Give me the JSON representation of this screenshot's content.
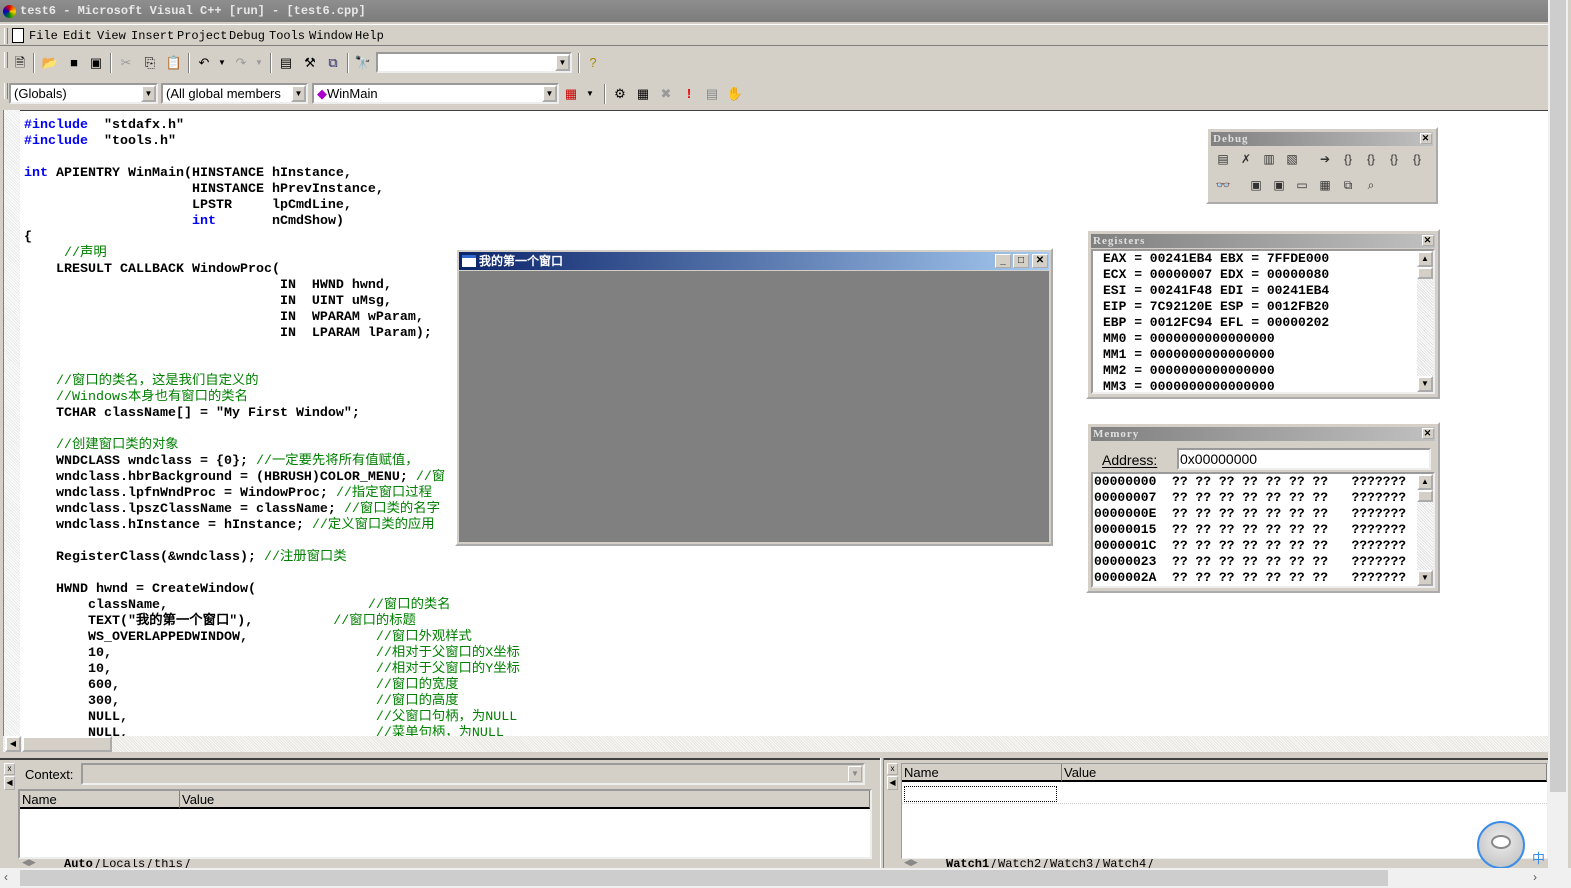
{
  "window": {
    "title": "test6 - Microsoft Visual C++ [run] - [test6.cpp]"
  },
  "menu": [
    "File",
    "Edit",
    "View",
    "Insert",
    "Project",
    "Debug",
    "Tools",
    "Window",
    "Help"
  ],
  "toolbar": {
    "icons": [
      "new-text-file",
      "open",
      "save",
      "save-all",
      "cut",
      "copy",
      "paste",
      "undo",
      "redo",
      "workspace",
      "output",
      "window-list",
      "find-in-files"
    ],
    "find_combo": "",
    "help_icon": "help-search"
  },
  "wizardbar": {
    "class_combo": "(Globals)",
    "filter_combo": "(All global members",
    "member_combo": "WinMain"
  },
  "code": [
    [
      [
        "kw",
        "#include"
      ],
      [
        "",
        "  \"stdafx.h\""
      ]
    ],
    [
      [
        "kw",
        "#include"
      ],
      [
        "",
        "  \"tools.h\""
      ]
    ],
    [],
    [
      [
        "kw",
        "int"
      ],
      [
        "",
        " APIENTRY WinMain(HINSTANCE hInstance,"
      ]
    ],
    [
      [
        "",
        "                     HINSTANCE hPrevInstance,"
      ]
    ],
    [
      [
        "",
        "                     LPSTR     lpCmdLine,"
      ]
    ],
    [
      [
        "",
        "                     "
      ],
      [
        "kw",
        "int"
      ],
      [
        "",
        "       nCmdShow)"
      ]
    ],
    [
      [
        "",
        "{"
      ]
    ],
    [
      [
        "cm",
        "     //声明"
      ]
    ],
    [
      [
        "",
        "    LRESULT CALLBACK WindowProc("
      ]
    ],
    [
      [
        "",
        "                                IN  HWND hwnd,"
      ]
    ],
    [
      [
        "",
        "                                IN  UINT uMsg,"
      ]
    ],
    [
      [
        "",
        "                                IN  WPARAM wParam,"
      ]
    ],
    [
      [
        "",
        "                                IN  LPARAM lParam);"
      ]
    ],
    [],
    [],
    [
      [
        "cm",
        "    //窗口的类名，这是我们自定义的"
      ]
    ],
    [
      [
        "cm",
        "    //Windows本身也有窗口的类名"
      ]
    ],
    [
      [
        "",
        "    TCHAR className[] = \"My First Window\";"
      ]
    ],
    [],
    [
      [
        "cm",
        "    //创建窗口类的对象"
      ]
    ],
    [
      [
        "",
        "    WNDCLASS wndclass = {0}; "
      ],
      [
        "cm",
        "//一定要先将所有值赋值，"
      ]
    ],
    [
      [
        "",
        "    wndclass.hbrBackground = (HBRUSH)COLOR_MENU; "
      ],
      [
        "cm",
        "//窗"
      ]
    ],
    [
      [
        "",
        "    wndclass.lpfnWndProc = WindowProc; "
      ],
      [
        "cm",
        "//指定窗口过程"
      ]
    ],
    [
      [
        "",
        "    wndclass.lpszClassName = className; "
      ],
      [
        "cm",
        "//窗口类的名字"
      ]
    ],
    [
      [
        "",
        "    wndclass.hInstance = hInstance; "
      ],
      [
        "cm",
        "//定义窗口类的应用"
      ]
    ],
    [],
    [
      [
        "",
        "    RegisterClass(&wndclass); "
      ],
      [
        "cm",
        "//注册窗口类"
      ]
    ],
    [],
    [
      [
        "",
        "    HWND hwnd = CreateWindow("
      ]
    ],
    [
      [
        "",
        "        className,                    "
      ],
      [
        "cm",
        "     //窗口的类名"
      ]
    ],
    [
      [
        "",
        "        TEXT(\"我的第一个窗口\"),          "
      ],
      [
        "cm",
        "//窗口的标题"
      ]
    ],
    [
      [
        "",
        "        WS_OVERLAPPEDWINDOW,                "
      ],
      [
        "cm",
        "//窗口外观样式"
      ]
    ],
    [
      [
        "",
        "        10,                                 "
      ],
      [
        "cm",
        "//相对于父窗口的X坐标"
      ]
    ],
    [
      [
        "",
        "        10,                                 "
      ],
      [
        "cm",
        "//相对于父窗口的Y坐标"
      ]
    ],
    [
      [
        "",
        "        600,                                "
      ],
      [
        "cm",
        "//窗口的宽度"
      ]
    ],
    [
      [
        "",
        "        300,                                "
      ],
      [
        "cm",
        "//窗口的高度"
      ]
    ],
    [
      [
        "",
        "        NULL,                               "
      ],
      [
        "cm",
        "//父窗口句柄，为NULL"
      ]
    ],
    [
      [
        "",
        "        NULL,                               "
      ],
      [
        "cm",
        "//菜单句柄，为NULL"
      ]
    ]
  ],
  "popup": {
    "title": "我的第一个窗口"
  },
  "debug_toolbar": {
    "title": "Debug",
    "row1": [
      "restart",
      "stop-debugging",
      "break-execution",
      "apply-code-changes",
      "show-next-statement",
      "step-into",
      "step-over",
      "step-out",
      "run-to-cursor"
    ],
    "row2": [
      "quickwatch",
      "watch",
      "variables",
      "registers",
      "memory",
      "call-stack",
      "disassembly"
    ]
  },
  "registers": {
    "title": "Registers",
    "lines": [
      "EAX = 00241EB4 EBX = 7FFDE000",
      "ECX = 00000007 EDX = 00000080",
      "ESI = 00241F48 EDI = 00241EB4",
      "EIP = 7C92120E ESP = 0012FB20",
      "EBP = 0012FC94 EFL = 00000202",
      "MM0 = 0000000000000000",
      "MM1 = 0000000000000000",
      "MM2 = 0000000000000000",
      "MM3 = 0000000000000000"
    ]
  },
  "memory": {
    "title": "Memory",
    "address_label": "Address:",
    "address_value": "0x00000000",
    "lines": [
      "00000000  ?? ?? ?? ?? ?? ?? ??   ???????",
      "00000007  ?? ?? ?? ?? ?? ?? ??   ???????",
      "0000000E  ?? ?? ?? ?? ?? ?? ??   ???????",
      "00000015  ?? ?? ?? ?? ?? ?? ??   ???????",
      "0000001C  ?? ?? ?? ?? ?? ?? ??   ???????",
      "00000023  ?? ?? ?? ?? ?? ?? ??   ???????",
      "0000002A  ?? ?? ?? ?? ?? ?? ??   ???????"
    ]
  },
  "variables": {
    "context_label": "Context:",
    "context_value": "",
    "columns": [
      "Name",
      "Value"
    ],
    "tabs": [
      "Auto",
      "Locals",
      "this"
    ],
    "active_tab": "Auto"
  },
  "watch": {
    "columns": [
      "Name",
      "Value"
    ],
    "tabs": [
      "Watch1",
      "Watch2",
      "Watch3",
      "Watch4"
    ],
    "active_tab": "Watch1"
  },
  "ime": {
    "label": "中"
  }
}
